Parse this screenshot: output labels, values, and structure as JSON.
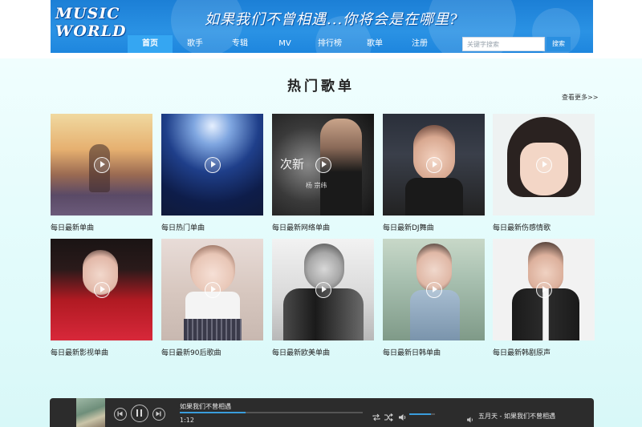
{
  "header": {
    "logo_line1": "MUSIC",
    "logo_line2": "WORLD",
    "slogan": "如果我们不曾相遇...你将会是在哪里?",
    "nav": [
      {
        "label": "首页",
        "active": true
      },
      {
        "label": "歌手",
        "active": false
      },
      {
        "label": "专辑",
        "active": false
      },
      {
        "label": "MV",
        "active": false
      },
      {
        "label": "排行榜",
        "active": false
      },
      {
        "label": "歌单",
        "active": false
      },
      {
        "label": "注册",
        "active": false
      }
    ],
    "search_placeholder": "关键字搜索",
    "search_button": "搜索"
  },
  "section": {
    "title": "热门歌单",
    "more": "查看更多>>"
  },
  "playlists": [
    {
      "caption": "每日最新单曲"
    },
    {
      "caption": "每日热门单曲"
    },
    {
      "caption": "每日最新网络单曲",
      "cover_text": "次新",
      "cover_subtext": "杨 宗纬"
    },
    {
      "caption": "每日最新DJ舞曲"
    },
    {
      "caption": "每日最新伤感情歌"
    },
    {
      "caption": "每日最新影视单曲"
    },
    {
      "caption": "每日最新90后歌曲"
    },
    {
      "caption": "每日最新欧美单曲"
    },
    {
      "caption": "每日最新日韩单曲"
    },
    {
      "caption": "每日最新韩剧原声"
    }
  ],
  "player": {
    "song_title": "如果我们不曾相遇",
    "current_time": "1:12",
    "progress": 0.36,
    "volume": 0.85,
    "now_playing": "五月天 - 如果我们不曾相遇"
  },
  "colors": {
    "header_blue": "#1e86de",
    "nav_active": "#35a6f2",
    "accent": "#3a9ddc",
    "player_bg": "#2c2c2c"
  }
}
